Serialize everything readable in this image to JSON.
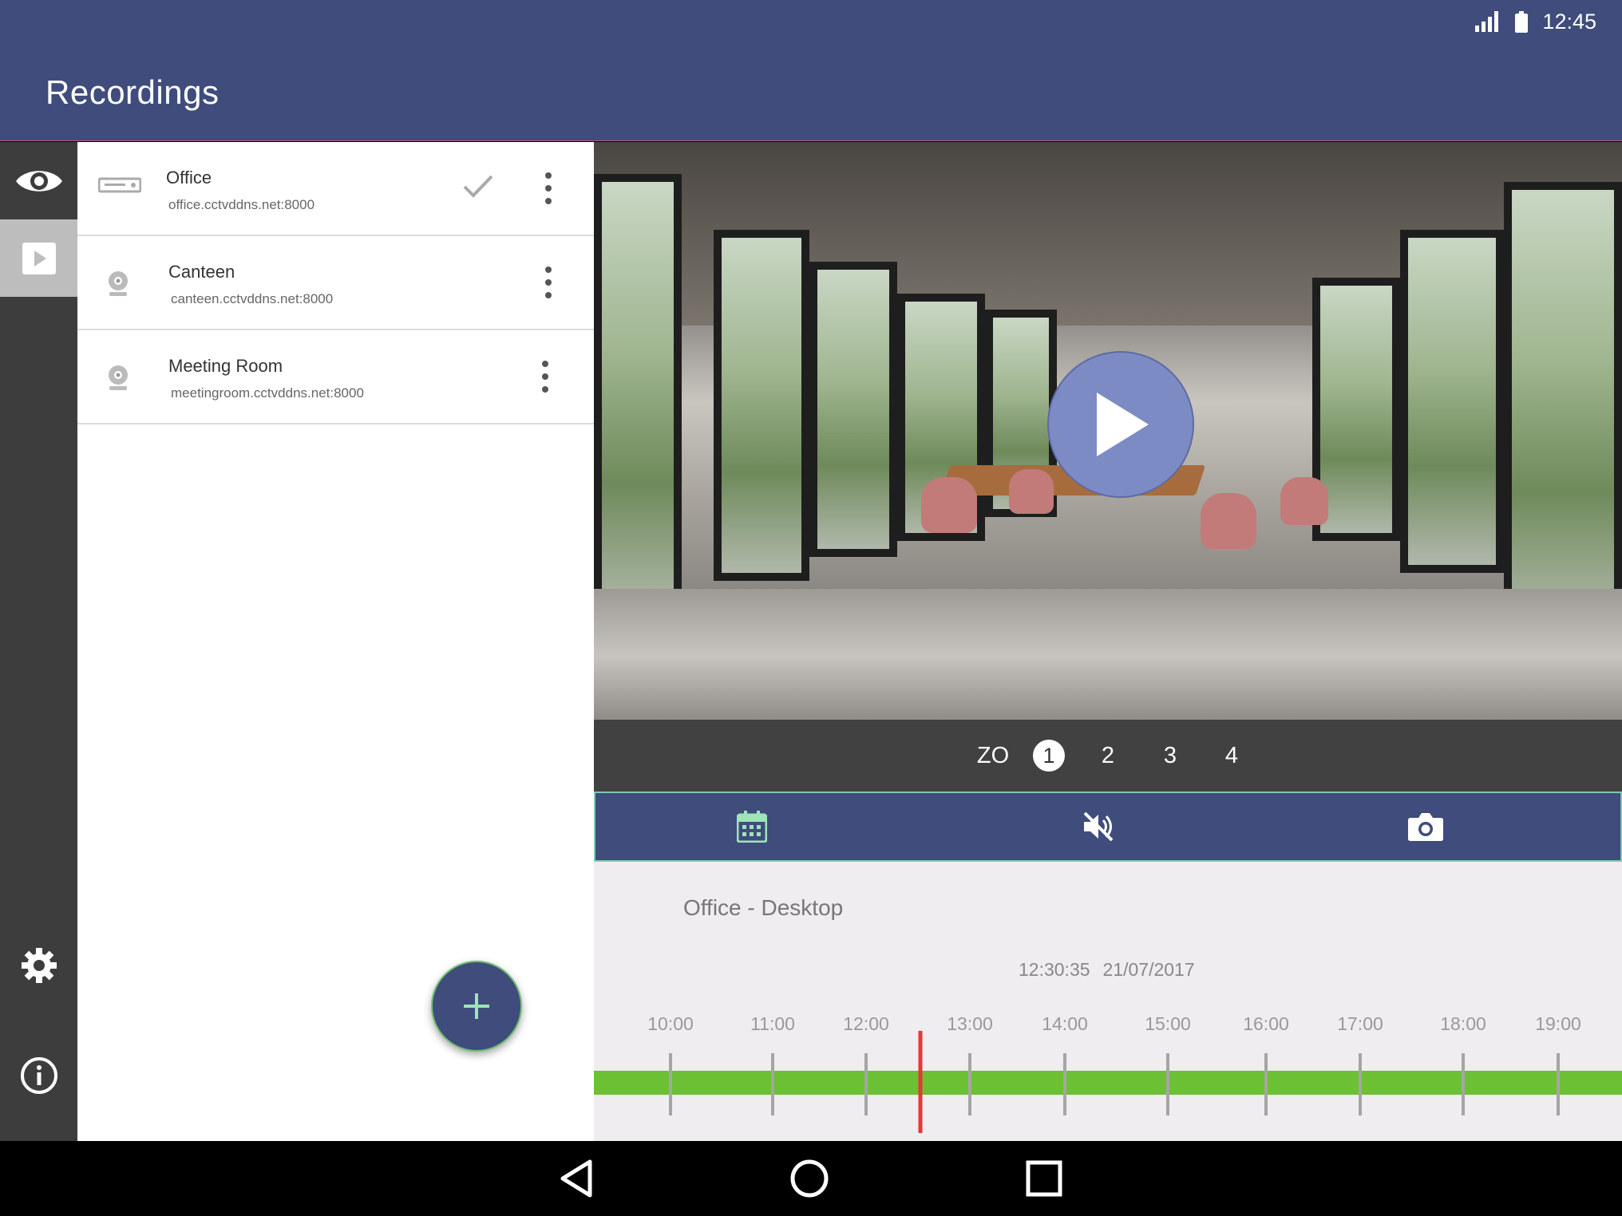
{
  "status_bar": {
    "time": "12:45",
    "icons": [
      "signal-icon",
      "battery-icon"
    ]
  },
  "app_bar": {
    "title": "Recordings",
    "color": "#3f4c7c"
  },
  "rail": {
    "items": [
      "eye-icon",
      "play-icon",
      "gear-icon",
      "info-icon"
    ],
    "active": "play-icon"
  },
  "devices": [
    {
      "name": "Office",
      "address": "office.cctvddns.net:8000",
      "icon": "dvr-icon",
      "selected": true
    },
    {
      "name": "Canteen",
      "address": "canteen.cctvddns.net:8000",
      "icon": "webcam-icon",
      "selected": false
    },
    {
      "name": "Meeting Room",
      "address": "meetingroom.cctvddns.net:8000",
      "icon": "webcam-icon",
      "selected": false
    }
  ],
  "fab": {
    "icon": "plus-icon"
  },
  "player": {
    "play_icon": "play-icon"
  },
  "channels": {
    "items": [
      "ZO",
      "1",
      "2",
      "3",
      "4"
    ],
    "active": "1"
  },
  "toolbar": {
    "icons": [
      "calendar-icon",
      "mute-icon",
      "camera-icon"
    ],
    "accent": "#7ec9b0"
  },
  "timeline": {
    "camera_title": "Office - Desktop",
    "time": "12:30:35",
    "date": "21/07/2017",
    "ticks": [
      "10:00",
      "11:00",
      "12:00",
      "13:00",
      "14:00",
      "15:00",
      "16:00",
      "17:00",
      "18:00",
      "19:00"
    ],
    "recording_color": "#6cc033",
    "cursor_color": "#e53935"
  },
  "nav_bar": {
    "icons": [
      "back-icon",
      "home-icon",
      "recents-icon"
    ]
  }
}
